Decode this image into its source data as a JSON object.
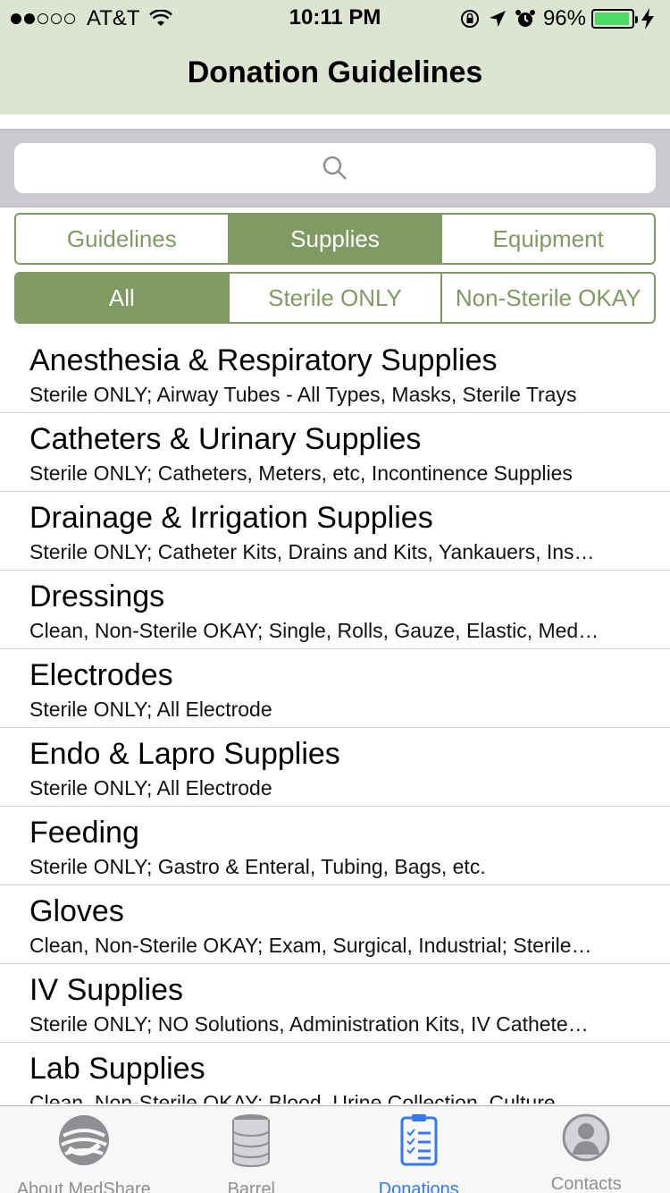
{
  "status": {
    "carrier": "AT&T",
    "time": "10:11 PM",
    "battery": "96%",
    "battery_level": 0.96
  },
  "nav": {
    "title": "Donation Guidelines"
  },
  "search": {
    "placeholder": ""
  },
  "category_tabs": [
    {
      "label": "Guidelines",
      "active": false
    },
    {
      "label": "Supplies",
      "active": true
    },
    {
      "label": "Equipment",
      "active": false
    }
  ],
  "filter_tabs": [
    {
      "label": "All",
      "active": true
    },
    {
      "label": "Sterile ONLY",
      "active": false
    },
    {
      "label": "Non-Sterile OKAY",
      "active": false
    }
  ],
  "items": [
    {
      "title": "Anesthesia & Respiratory Supplies",
      "subtitle": "Sterile ONLY; Airway Tubes - All Types, Masks, Sterile Trays"
    },
    {
      "title": "Catheters & Urinary Supplies",
      "subtitle": "Sterile ONLY; Catheters, Meters, etc, Incontinence Supplies"
    },
    {
      "title": "Drainage & Irrigation Supplies",
      "subtitle": "Sterile ONLY; Catheter Kits, Drains and Kits, Yankauers, Ins…"
    },
    {
      "title": "Dressings",
      "subtitle": "Clean, Non-Sterile OKAY; Single, Rolls, Gauze, Elastic, Med…"
    },
    {
      "title": "Electrodes",
      "subtitle": "Sterile ONLY; All Electrode"
    },
    {
      "title": "Endo & Lapro Supplies",
      "subtitle": "Sterile ONLY; All Electrode"
    },
    {
      "title": "Feeding",
      "subtitle": "Sterile ONLY; Gastro & Enteral, Tubing, Bags, etc."
    },
    {
      "title": "Gloves",
      "subtitle": "Clean, Non-Sterile OKAY; Exam, Surgical, Industrial; Sterile…"
    },
    {
      "title": "IV Supplies",
      "subtitle": "Sterile ONLY; NO Solutions, Administration Kits, IV Cathete…"
    },
    {
      "title": "Lab Supplies",
      "subtitle": "Clean, Non-Sterile OKAY; Blood, Urine Collection, Culture…"
    }
  ],
  "tabbar": [
    {
      "label": "About MedShare",
      "icon": "globe-hand-icon",
      "active": false
    },
    {
      "label": "Barrel",
      "icon": "barrel-icon",
      "active": false
    },
    {
      "label": "Donations",
      "icon": "clipboard-list-icon",
      "active": true
    },
    {
      "label": "Contacts",
      "icon": "person-icon",
      "active": false
    }
  ],
  "colors": {
    "accent": "#7f9a63",
    "nav_background": "#dde5d2",
    "tab_active": "#3478f6",
    "tab_inactive": "#8e8e93"
  }
}
